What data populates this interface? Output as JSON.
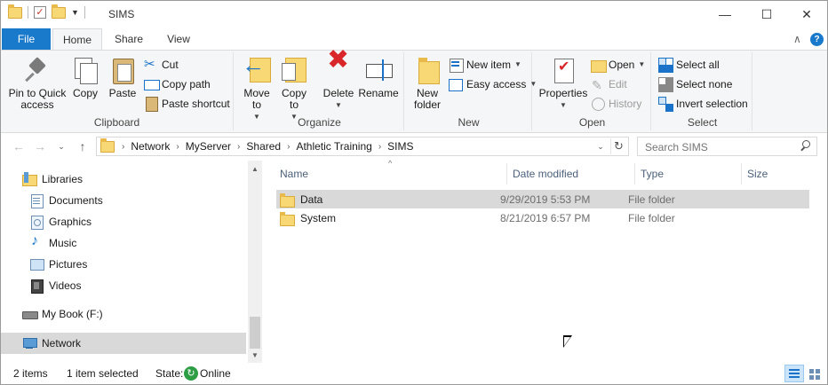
{
  "window": {
    "title": "SIMS",
    "controls": {
      "minimize": "—",
      "maximize": "☐",
      "close": "✕"
    }
  },
  "tabs": {
    "file": "File",
    "home": "Home",
    "share": "Share",
    "view": "View",
    "collapse": "∧",
    "help": "?"
  },
  "ribbon": {
    "clipboard": {
      "label": "Clipboard",
      "pin": "Pin to Quick access",
      "copy": "Copy",
      "paste": "Paste",
      "cut": "Cut",
      "copy_path": "Copy path",
      "paste_shortcut": "Paste shortcut"
    },
    "organize": {
      "label": "Organize",
      "move_to": "Move to",
      "copy_to": "Copy to",
      "delete": "Delete",
      "rename": "Rename"
    },
    "new": {
      "label": "New",
      "new_folder": "New folder",
      "new_item": "New item",
      "easy_access": "Easy access"
    },
    "open": {
      "label": "Open",
      "properties": "Properties",
      "open": "Open",
      "edit": "Edit",
      "history": "History"
    },
    "select": {
      "label": "Select",
      "select_all": "Select all",
      "select_none": "Select none",
      "invert_selection": "Invert selection"
    }
  },
  "address": {
    "breadcrumbs": [
      "Network",
      "MyServer",
      "Shared",
      "Athletic Training",
      "SIMS"
    ],
    "search_placeholder": "Search SIMS"
  },
  "nav_pane": {
    "items": [
      {
        "label": "Libraries",
        "icon": "libraries-icon"
      },
      {
        "label": "Documents",
        "icon": "documents-icon"
      },
      {
        "label": "Graphics",
        "icon": "graphics-icon"
      },
      {
        "label": "Music",
        "icon": "music-icon"
      },
      {
        "label": "Pictures",
        "icon": "pictures-icon"
      },
      {
        "label": "Videos",
        "icon": "videos-icon"
      },
      {
        "label": "My Book (F:)",
        "icon": "drive-icon"
      },
      {
        "label": "Network",
        "icon": "network-icon",
        "selected": true
      }
    ]
  },
  "file_list": {
    "columns": {
      "name": "Name",
      "date": "Date modified",
      "type": "Type",
      "size": "Size"
    },
    "rows": [
      {
        "name": "Data",
        "date": "9/29/2019 5:53 PM",
        "type": "File folder",
        "selected": true
      },
      {
        "name": "System",
        "date": "8/21/2019 6:57 PM",
        "type": "File folder",
        "selected": false
      }
    ]
  },
  "status": {
    "item_count": "2 items",
    "selected": "1 item selected",
    "state_label": "State:",
    "state_value": "Online"
  },
  "colors": {
    "accent": "#1979ca",
    "selection": "#d9d9d9",
    "folder": "#f8d775",
    "online": "#2e9e45"
  }
}
